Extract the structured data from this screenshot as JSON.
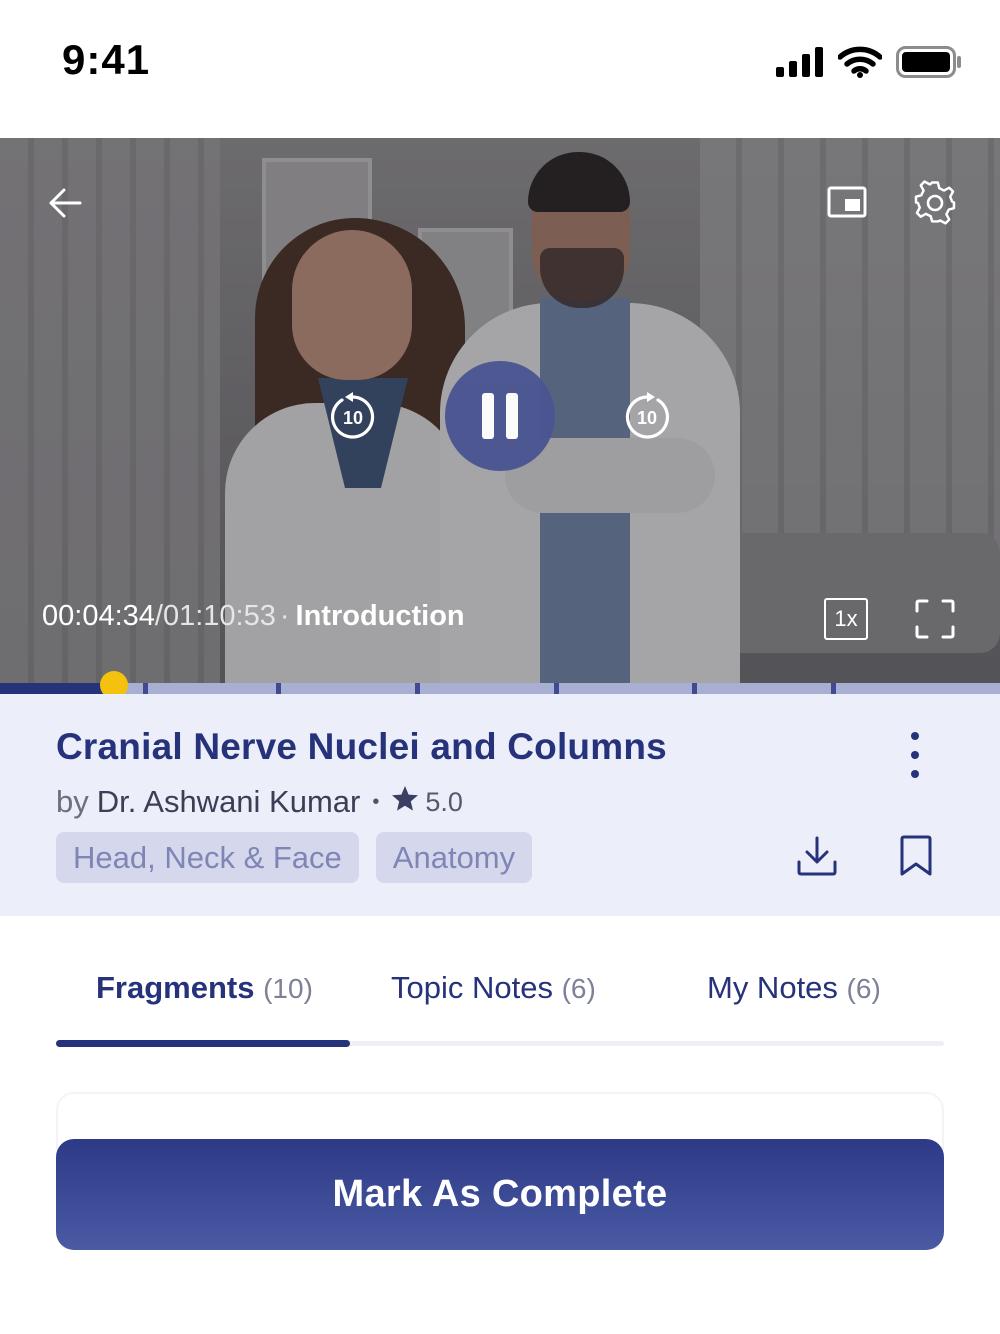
{
  "status_bar": {
    "time": "9:41",
    "icons": [
      "cellular-signal-icon",
      "wifi-icon",
      "battery-icon"
    ]
  },
  "video": {
    "controls": {
      "back_icon": "arrow-left-icon",
      "pip_icon": "picture-in-picture-icon",
      "settings_icon": "gear-icon",
      "rewind_icon": "rewind-10-icon",
      "rewind_label": "10",
      "play_state_icon": "pause-icon",
      "forward_icon": "forward-10-icon",
      "forward_label": "10",
      "fullscreen_icon": "fullscreen-icon"
    },
    "current_time": "00:04:34",
    "total_time": "/01:10:53",
    "separator": "·",
    "chapter": "Introduction",
    "speed": "1x",
    "progress": {
      "played_fraction": 0.114,
      "chapter_marks": [
        0.145,
        0.278,
        0.417,
        0.556,
        0.694,
        0.833
      ]
    }
  },
  "lecture": {
    "title": "Cranial Nerve Nuclei and Columns",
    "author_prefix": "by",
    "author": "Dr. Ashwani Kumar",
    "rating_separator": "•",
    "rating": "5.0",
    "tags": [
      "Head, Neck & Face",
      "Anatomy"
    ],
    "actions": [
      "more-vertical-icon",
      "download-icon",
      "bookmark-icon"
    ]
  },
  "tabs": [
    {
      "label": "Fragments",
      "count": "(10)",
      "active": true
    },
    {
      "label": "Topic Notes",
      "count": "(6)",
      "active": false
    },
    {
      "label": "My Notes",
      "count": "(6)",
      "active": false
    }
  ],
  "cta": {
    "label": "Mark As Complete"
  },
  "colors": {
    "primary": "#26327a",
    "accent": "#f4c20d",
    "panel_bg": "#eceef9",
    "tag_bg": "#d5d8ec"
  }
}
